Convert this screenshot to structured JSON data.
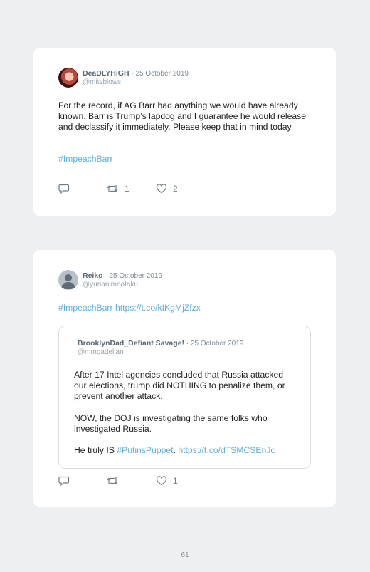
{
  "tweets": [
    {
      "name": "DeaDLYHiGH",
      "date": "· 25 October 2019",
      "handle": "@mitsblows",
      "text": "For the record, if AG Barr had anything we would have already known. Barr is Trump’s lapdog and I guarantee he would release and declassify it immediately. Please keep that in mind today.",
      "hashtag": "#ImpeachBarr",
      "retweets": "1",
      "likes": "2"
    },
    {
      "name": "Reiko",
      "date": "· 25 October 2019",
      "handle": "@yurianimeotaku",
      "hashtag": "#ImpeachBarr",
      "link": "https://t.co/kIKgMjZfzx",
      "likes": "1",
      "quote": {
        "name": "BrooklynDad_Defiant Savage!",
        "date": "· 25 October 2019",
        "handle": "@mmpadellan",
        "paragraph1": "After 17 Intel agencies concluded that Russia attacked our elections, trump did NOTHING to penalize them, or prevent another attack.",
        "paragraph2": "NOW, the DOJ is investigating the same folks who investigated Russia.",
        "paragraph3_prefix": "He truly IS ",
        "paragraph3_hashtag": "#PutinsPuppet",
        "paragraph3_sep": ". ",
        "paragraph3_link": "https://t.co/dTSMCSEnJc"
      }
    }
  ],
  "page_number": "61",
  "colors": {
    "background": "#eeeff1",
    "card": "#ffffff",
    "link": "#5fb0de",
    "meta": "#98a3ae"
  },
  "icons": [
    "reply-icon",
    "retweet-icon",
    "like-icon",
    "default-avatar-icon"
  ]
}
